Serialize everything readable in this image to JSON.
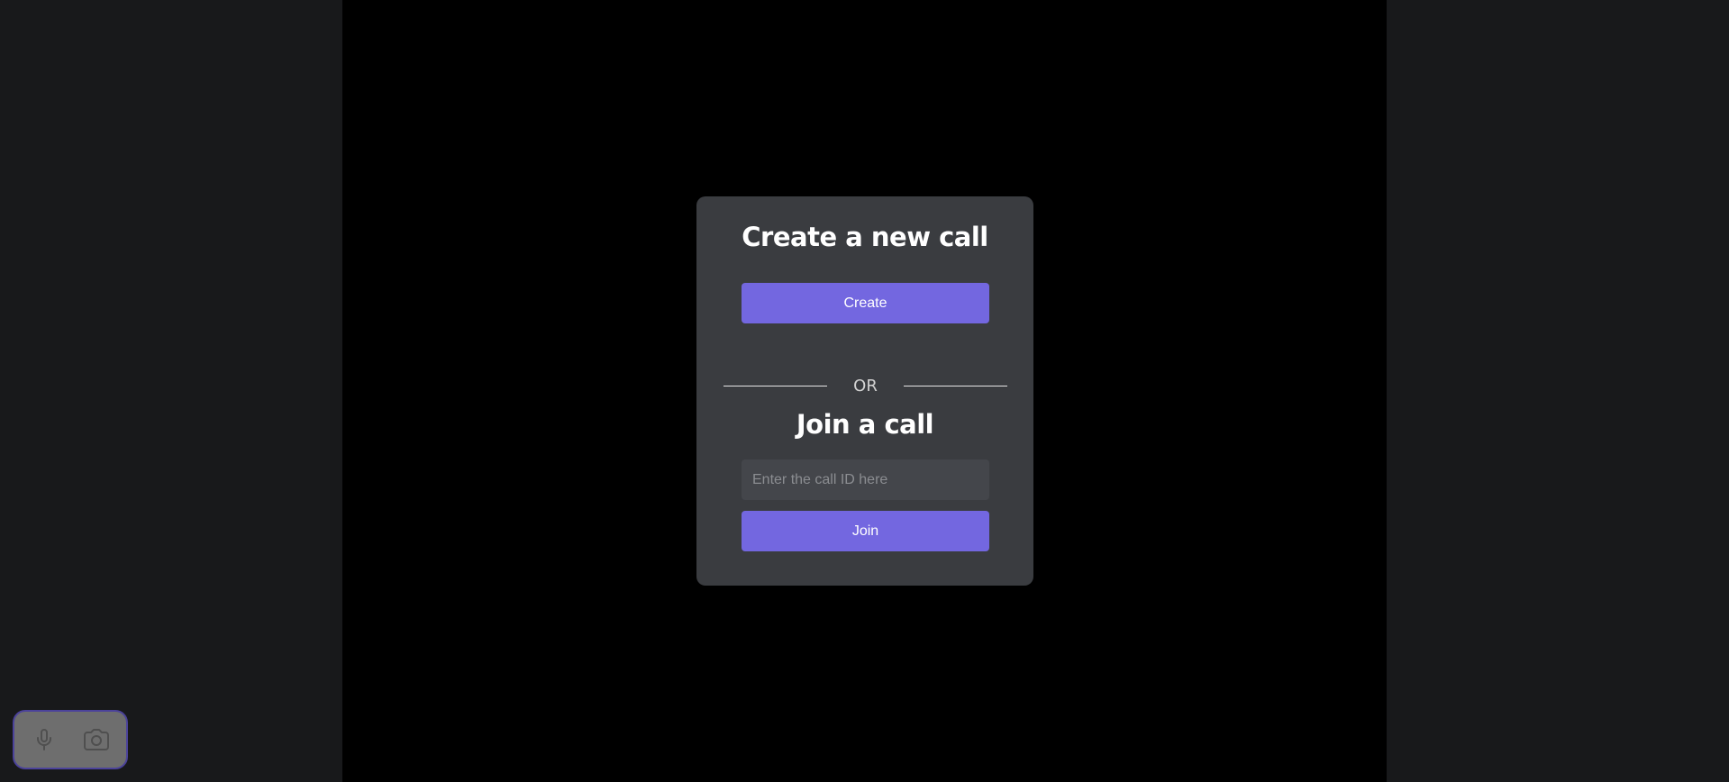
{
  "create_section": {
    "title": "Create a new call",
    "button_label": "Create"
  },
  "divider": {
    "text": "OR"
  },
  "join_section": {
    "title": "Join a call",
    "input_value": "",
    "input_placeholder": "Enter the call ID here",
    "button_label": "Join"
  },
  "media_controls": {
    "icons": [
      "microphone-icon",
      "camera-icon"
    ]
  },
  "colors": {
    "accent": "#7367e0",
    "card_background": "#3a3c40",
    "page_background": "#000000",
    "side_panel_background": "#18191b",
    "controls_border": "#4b429a"
  }
}
